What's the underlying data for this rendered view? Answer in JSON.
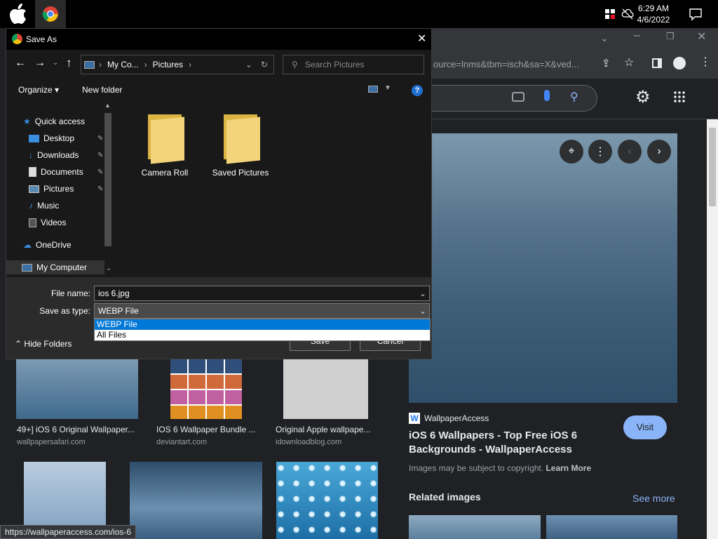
{
  "taskbar": {
    "time": "6:29 AM",
    "date": "4/6/2022",
    "icons": [
      "apple-icon",
      "chrome-icon",
      "security-icon",
      "network-off-icon",
      "notification-icon"
    ]
  },
  "browser": {
    "url_fragment": "ource=lnms&tbm=isch&sa=X&ved...",
    "status_url": "https://wallpaperaccess.com/ios-6"
  },
  "results": [
    {
      "title": "49+] iOS 6 Original Wallpaper...",
      "source": "wallpapersafari.com"
    },
    {
      "title": "IOS 6 Wallpaper Bundle ...",
      "source": "deviantart.com"
    },
    {
      "title": "Original Apple wallpape...",
      "source": "idownloadblog.com"
    }
  ],
  "panel": {
    "site": "WallpaperAccess",
    "site_logo": "W",
    "title": "iOS 6 Wallpapers - Top Free iOS 6 Backgrounds - WallpaperAccess",
    "visit": "Visit",
    "copyright": "Images may be subject to copyright.",
    "learn_more": "Learn More",
    "related": "Related images",
    "see_more": "See more"
  },
  "dialog": {
    "title": "Save As",
    "breadcrumb": [
      "My Co...",
      "Pictures"
    ],
    "search_placeholder": "Search Pictures",
    "organize": "Organize",
    "new_folder": "New folder",
    "nav": {
      "quick_access": "Quick access",
      "items": [
        {
          "label": "Desktop",
          "pinned": true
        },
        {
          "label": "Downloads",
          "pinned": true
        },
        {
          "label": "Documents",
          "pinned": true
        },
        {
          "label": "Pictures",
          "pinned": true
        },
        {
          "label": "Music",
          "pinned": false
        },
        {
          "label": "Videos",
          "pinned": false
        }
      ],
      "onedrive": "OneDrive",
      "my_computer": "My Computer"
    },
    "folders": [
      "Camera Roll",
      "Saved Pictures"
    ],
    "file_name_label": "File name:",
    "file_name": "ios 6.jpg",
    "save_type_label": "Save as type:",
    "save_type": "WEBP File",
    "type_options": [
      "WEBP File",
      "All Files"
    ],
    "hide_folders": "Hide Folders",
    "save": "Save",
    "cancel": "Cancel"
  }
}
